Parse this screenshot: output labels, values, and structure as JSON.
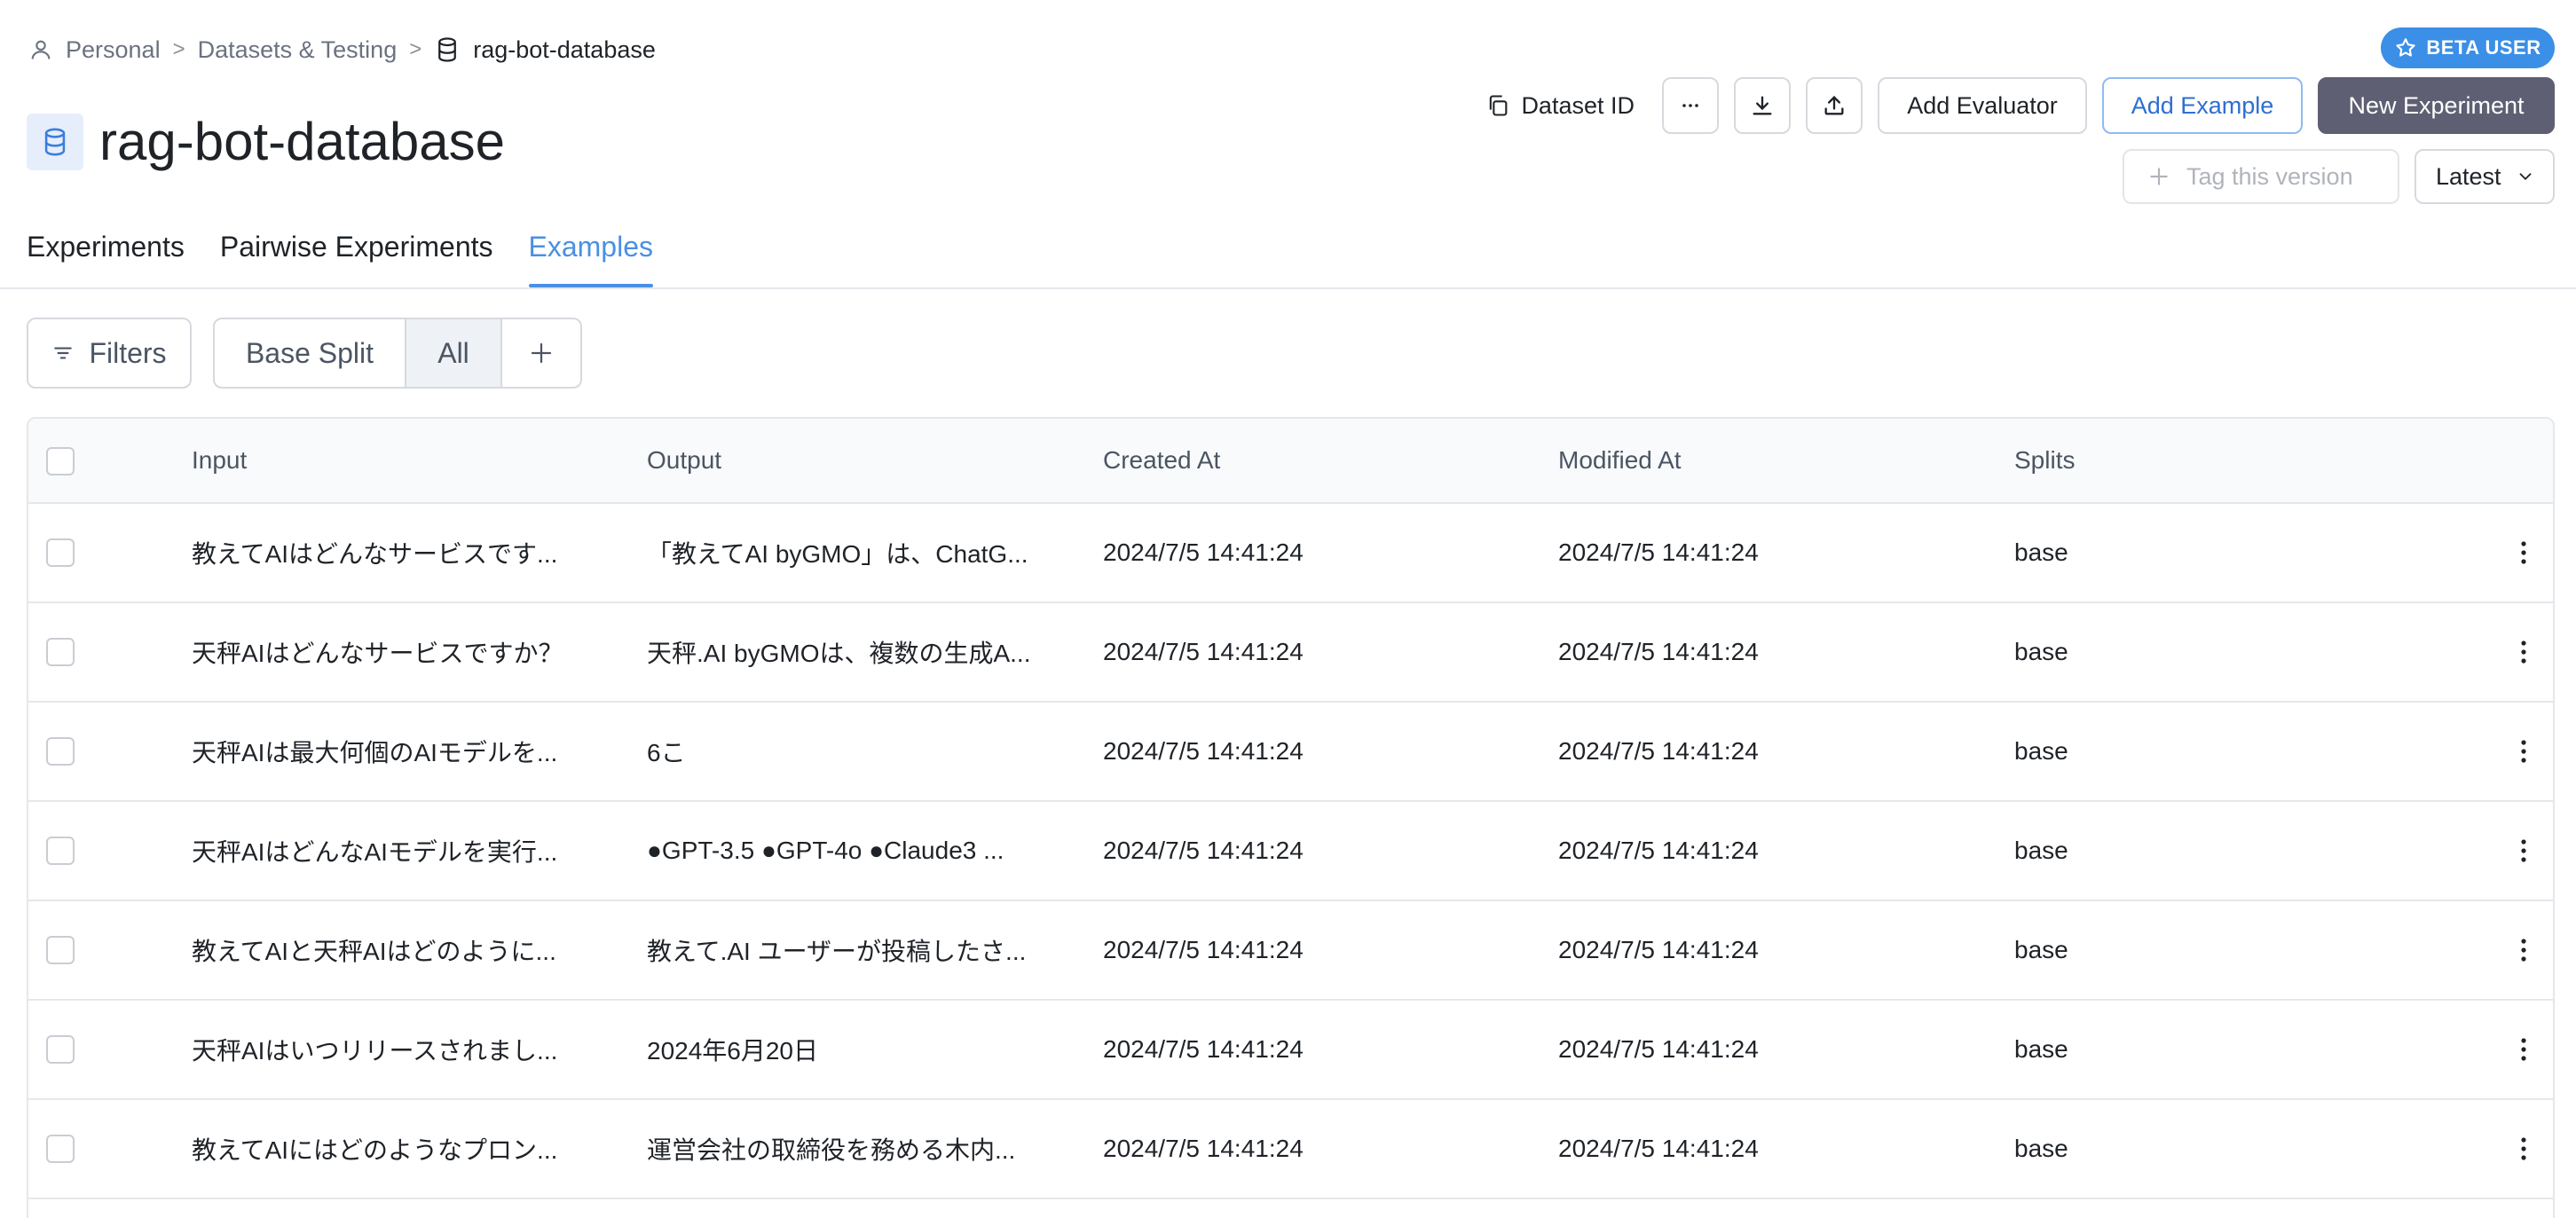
{
  "breadcrumb": {
    "personal": "Personal",
    "datasets": "Datasets & Testing",
    "current": "rag-bot-database",
    "separator": ">"
  },
  "badge": {
    "label": "BETA USER"
  },
  "page": {
    "title": "rag-bot-database"
  },
  "toolbar": {
    "dataset_id": "Dataset ID",
    "add_evaluator": "Add Evaluator",
    "add_example": "Add Example",
    "new_experiment": "New Experiment",
    "tag_version": "Tag this version",
    "version_select": "Latest"
  },
  "tabs": [
    {
      "label": "Experiments",
      "active": false
    },
    {
      "label": "Pairwise Experiments",
      "active": false
    },
    {
      "label": "Examples",
      "active": true
    }
  ],
  "filters": {
    "label": "Filters"
  },
  "splits": {
    "base": "Base Split",
    "all": "All",
    "add": "+"
  },
  "table": {
    "columns": {
      "input": "Input",
      "output": "Output",
      "created": "Created At",
      "modified": "Modified At",
      "splits": "Splits"
    },
    "rows": [
      {
        "input": "教えてAIはどんなサービスです...",
        "output": "「教えてAI byGMO」は、ChatG...",
        "created": "2024/7/5 14:41:24",
        "modified": "2024/7/5 14:41:24",
        "splits": "base"
      },
      {
        "input": "天秤AIはどんなサービスですか？",
        "output": "天秤.AI byGMOは、複数の生成A...",
        "created": "2024/7/5 14:41:24",
        "modified": "2024/7/5 14:41:24",
        "splits": "base"
      },
      {
        "input": "天秤AIは最大何個のAIモデルを...",
        "output": "6こ",
        "created": "2024/7/5 14:41:24",
        "modified": "2024/7/5 14:41:24",
        "splits": "base"
      },
      {
        "input": "天秤AIはどんなAIモデルを実行...",
        "output": "●GPT-3.5 ●GPT-4o ●Claude3 ...",
        "created": "2024/7/5 14:41:24",
        "modified": "2024/7/5 14:41:24",
        "splits": "base"
      },
      {
        "input": "教えてAIと天秤AIはどのように...",
        "output": "教えて.AI ユーザーが投稿したさ...",
        "created": "2024/7/5 14:41:24",
        "modified": "2024/7/5 14:41:24",
        "splits": "base"
      },
      {
        "input": "天秤AIはいつリリースされまし...",
        "output": "2024年6月20日",
        "created": "2024/7/5 14:41:24",
        "modified": "2024/7/5 14:41:24",
        "splits": "base"
      },
      {
        "input": "教えてAIにはどのようなプロン...",
        "output": "運営会社の取締役を務める木内...",
        "created": "2024/7/5 14:41:24",
        "modified": "2024/7/5 14:41:24",
        "splits": "base"
      }
    ]
  },
  "colors": {
    "accent": "#4a90e2",
    "beta_badge": "#3b8fe6",
    "primary_button": "#5f5f73",
    "border": "#d6d9de"
  },
  "icons": {
    "breadcrumb_personal": "user-icon",
    "breadcrumb_dataset": "database-icon",
    "badge": "star-icon",
    "dataset_id": "copy-icon",
    "more": "ellipsis-icon",
    "download": "download-icon",
    "upload": "upload-icon",
    "tag": "plus-icon",
    "version": "chevron-down-icon",
    "filters": "filter-icon",
    "row_menu": "kebab-icon"
  }
}
